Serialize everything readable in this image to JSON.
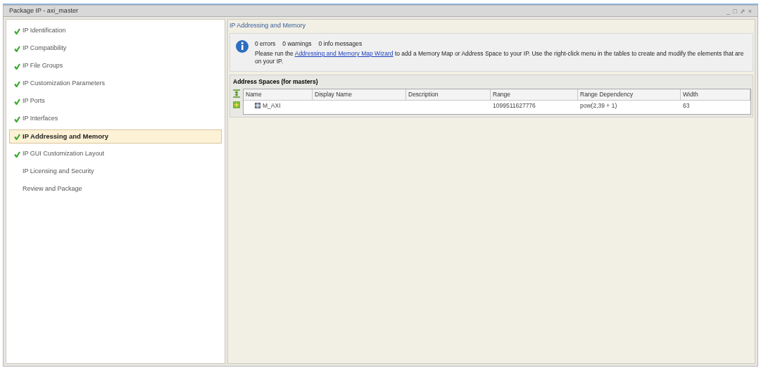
{
  "window": {
    "title": "Package IP - axi_master",
    "controls": [
      "_",
      "□",
      "⇗",
      "×"
    ]
  },
  "sidebar": {
    "items": [
      {
        "label": "IP Identification",
        "checked": true,
        "selected": false
      },
      {
        "label": "IP Compatibility",
        "checked": true,
        "selected": false
      },
      {
        "label": "IP File Groups",
        "checked": true,
        "selected": false
      },
      {
        "label": "IP Customization Parameters",
        "checked": true,
        "selected": false
      },
      {
        "label": "IP Ports",
        "checked": true,
        "selected": false
      },
      {
        "label": "IP Interfaces",
        "checked": true,
        "selected": false
      },
      {
        "label": "IP Addressing and Memory",
        "checked": true,
        "selected": true
      },
      {
        "label": "IP GUI Customization Layout",
        "checked": true,
        "selected": false
      },
      {
        "label": "IP Licensing and Security",
        "checked": false,
        "selected": false
      },
      {
        "label": "Review and Package",
        "checked": false,
        "selected": false
      }
    ]
  },
  "main": {
    "heading": "IP Addressing and Memory",
    "info": {
      "counts": [
        "0 errors",
        "0 warnings",
        "0 info messages"
      ],
      "message_before": "Please run the",
      "link": "Addressing and Memory Map Wizard",
      "message_after": "to add a Memory Map or Address Space to your IP. Use the right-click menu in the tables to create and modify the elements that are on your IP."
    },
    "table": {
      "title": "Address Spaces (for masters)",
      "columns": [
        "Name",
        "Display Name",
        "Description",
        "Range",
        "Range Dependency",
        "Width"
      ],
      "rows": [
        [
          "M_AXI",
          "",
          "",
          "1099511627776",
          "pow(2,39 + 1)",
          "63"
        ]
      ]
    }
  }
}
